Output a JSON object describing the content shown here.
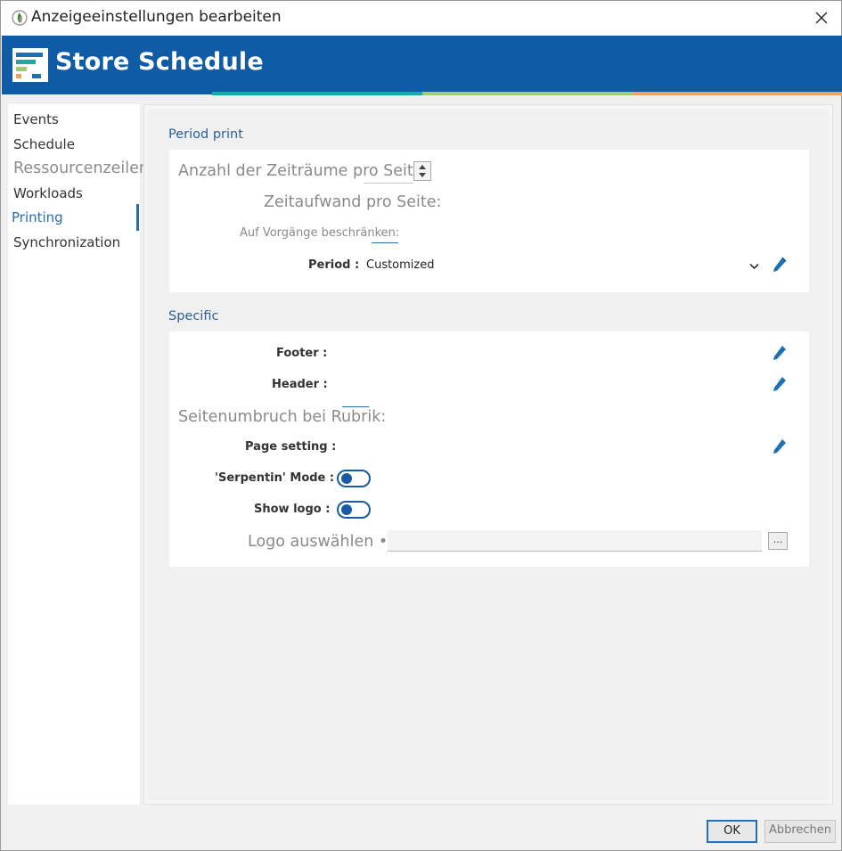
{
  "window": {
    "title": "Anzeigeeinstellungen bearbeiten"
  },
  "banner": {
    "title": "Store Schedule",
    "stripe_colors": [
      "#1aa9a3",
      "#9fce6e",
      "#f2a159"
    ]
  },
  "sidebar": {
    "items": [
      {
        "label": "Events",
        "state": "normal"
      },
      {
        "label": "Schedule",
        "state": "normal"
      },
      {
        "label": "Ressourcenzeilen",
        "state": "ghost"
      },
      {
        "label": "Workloads",
        "state": "normal"
      },
      {
        "label": "Printing",
        "state": "active"
      },
      {
        "label": "Synchronization",
        "state": "normal"
      }
    ]
  },
  "period_print": {
    "title": "Period print",
    "pages_label": "Anzahl der Zeiträume pro Seite:",
    "time_label": "Zeitaufwand pro Seite:",
    "restrict_label": "Auf Vorgänge beschränken:",
    "period_label": "Period :",
    "period_value": "Customized"
  },
  "specific": {
    "title": "Specific",
    "footer_label": "Footer :",
    "header_label": "Header :",
    "pagebreak_label": "Seitenumbruch bei Rubrik:",
    "page_setting_label": "Page setting :",
    "serpentin_label": "'Serpentin' Mode :",
    "show_logo_label": "Show logo :",
    "choose_logo_label": "Logo auswählen •",
    "browse_label": "..."
  },
  "buttons": {
    "ok": "OK",
    "cancel": "Abbrechen"
  },
  "colors": {
    "banner": "#0f5ba6",
    "accent": "#2a6db0",
    "toggle": "#1a5aa0"
  }
}
